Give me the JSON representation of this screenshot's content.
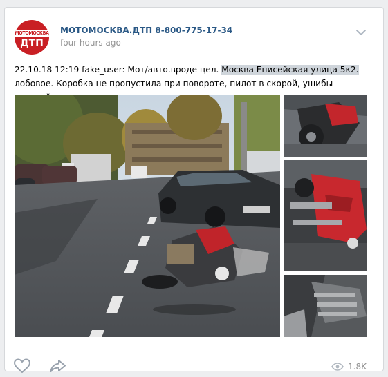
{
  "post": {
    "group": {
      "name": "МОТОМОСКВА.ДТП 8-800-775-17-34",
      "avatar_top_text": "МОТОМОСКВА",
      "avatar_main_text": "ДТП"
    },
    "time": "four hours ago",
    "text_before": "22.10.18 12:19 fake_user: Мот/авто.вроде цел. ",
    "text_highlight": "Москва Енисейская улица 5к2.",
    "text_after": " лобовое. Коробка не пропустила при повороте, пилот в скорой, ушибы голеней..",
    "views": "1.8K"
  },
  "icons": {
    "menu": "chevron-down-icon",
    "like": "heart-icon",
    "share": "share-arrow-icon",
    "views": "eye-icon"
  },
  "colors": {
    "link": "#2a5885",
    "meta": "#939393",
    "highlight": "#cfd5db",
    "brand_red": "#c91f24",
    "icon": "#99a2ad"
  }
}
